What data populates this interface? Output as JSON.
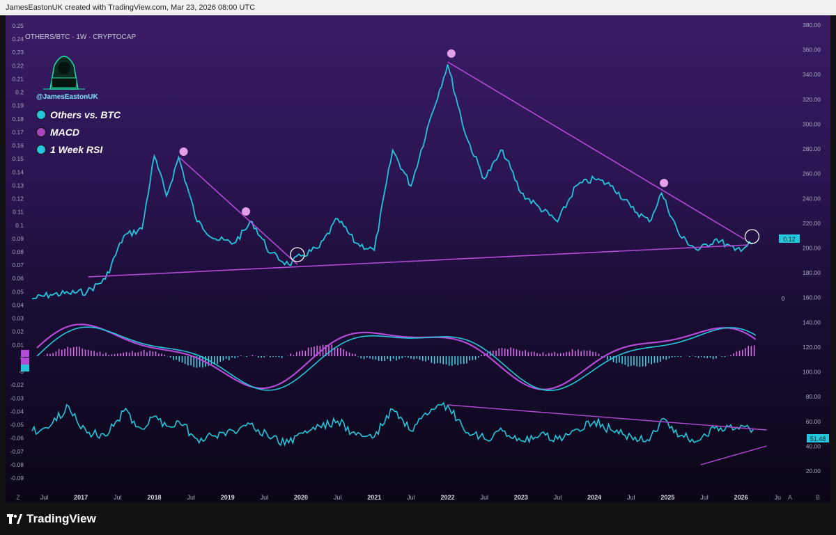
{
  "header": {
    "text": "JamesEastonUK created with TradingView.com, Mar 23, 2026 08:00 UTC"
  },
  "symbol": "OTHERS/BTC · 1W · CRYPTOCAP",
  "watermark": {
    "handle": "@JamesEastonUK"
  },
  "legend": [
    {
      "label": "Others vs. BTC",
      "color": "#26c6da"
    },
    {
      "label": "MACD",
      "color": "#ab47bc"
    },
    {
      "label": "1 Week RSI",
      "color": "#26c6da"
    }
  ],
  "footer": {
    "brand": "TradingView",
    "logo_icon": "tradingview-logo-icon"
  },
  "badges": {
    "price": "0.12",
    "rsi": "51.48",
    "macd_zero": "0"
  },
  "colors": {
    "line": "#26c6da",
    "magenta": "#b44bd6",
    "pink_dot": "#e3a0e8",
    "bar_pos": "#d36ee6",
    "bar_neg": "#4dd0e1"
  },
  "chart_data": {
    "type": "line",
    "title": "OTHERS/BTC · 1W · CRYPTOCAP",
    "x_ticks": [
      "Jul",
      "2017",
      "Jul",
      "2018",
      "Jul",
      "2019",
      "Jul",
      "2020",
      "Jul",
      "2021",
      "Jul",
      "2022",
      "Jul",
      "2023",
      "Jul",
      "2024",
      "Jul",
      "2025",
      "Jul",
      "2026",
      "Ju"
    ],
    "left_axis_ticks": [
      "0.25",
      "0.24",
      "0.23",
      "0.22",
      "0.21",
      "0.2",
      "0.19",
      "0.18",
      "0.17",
      "0.16",
      "0.15",
      "0.14",
      "0.13",
      "0.12",
      "0.11",
      "0.1",
      "0.09",
      "0.08",
      "0.07",
      "0.06",
      "0.05",
      "0.04",
      "0.03",
      "0.02",
      "0.01",
      "0",
      "-0",
      "-0.02",
      "-0.03",
      "-0.04",
      "-0.05",
      "-0.06",
      "-0.07",
      "-0.08",
      "-0.09"
    ],
    "right_axis_ticks": [
      "380.00",
      "360.00",
      "340.00",
      "320.00",
      "300.00",
      "280.00",
      "260.00",
      "240.00",
      "220.00",
      "200.00",
      "180.00",
      "160.00",
      "140.00",
      "120.00",
      "100.00",
      "80.00",
      "60.00",
      "40.00",
      "20.00"
    ],
    "axis_corner_labels": {
      "left": "Z",
      "auto": "A",
      "log": "B"
    },
    "series": [
      {
        "name": "Others vs. BTC",
        "x": [
          "2016-05",
          "2016-08",
          "2016-11",
          "2017-02",
          "2017-05",
          "2017-08",
          "2017-11",
          "2018-01",
          "2018-03",
          "2018-05",
          "2018-08",
          "2018-11",
          "2019-02",
          "2019-05",
          "2019-08",
          "2019-11",
          "2020-01",
          "2020-04",
          "2020-07",
          "2020-10",
          "2021-01",
          "2021-04",
          "2021-07",
          "2021-10",
          "2022-01",
          "2022-04",
          "2022-07",
          "2022-10",
          "2023-01",
          "2023-04",
          "2023-07",
          "2023-10",
          "2024-01",
          "2024-04",
          "2024-07",
          "2024-10",
          "2024-12",
          "2025-03",
          "2025-06",
          "2025-09",
          "2025-12",
          "2026-03"
        ],
        "values": [
          0.046,
          0.049,
          0.05,
          0.051,
          0.06,
          0.09,
          0.095,
          0.146,
          0.118,
          0.145,
          0.1,
          0.088,
          0.085,
          0.1,
          0.078,
          0.07,
          0.076,
          0.082,
          0.102,
          0.085,
          0.08,
          0.15,
          0.125,
          0.17,
          0.21,
          0.16,
          0.13,
          0.15,
          0.12,
          0.11,
          0.1,
          0.125,
          0.13,
          0.125,
          0.11,
          0.1,
          0.12,
          0.09,
          0.08,
          0.088,
          0.08,
          0.085
        ]
      },
      {
        "name": "1 Week RSI",
        "x": [
          "2016-05",
          "2016-08",
          "2016-11",
          "2017-02",
          "2017-05",
          "2017-08",
          "2017-11",
          "2018-01",
          "2018-03",
          "2018-05",
          "2018-08",
          "2018-11",
          "2019-02",
          "2019-05",
          "2019-08",
          "2019-11",
          "2020-01",
          "2020-04",
          "2020-07",
          "2020-10",
          "2021-01",
          "2021-04",
          "2021-07",
          "2021-10",
          "2022-01",
          "2022-04",
          "2022-07",
          "2022-10",
          "2023-01",
          "2023-04",
          "2023-07",
          "2023-10",
          "2024-01",
          "2024-04",
          "2024-07",
          "2024-10",
          "2024-12",
          "2025-03",
          "2025-06",
          "2025-09",
          "2025-12",
          "2026-03"
        ],
        "values": [
          50,
          55,
          75,
          48,
          45,
          70,
          52,
          65,
          55,
          60,
          42,
          45,
          50,
          58,
          42,
          38,
          48,
          55,
          60,
          46,
          44,
          72,
          50,
          68,
          76,
          48,
          42,
          50,
          40,
          45,
          42,
          52,
          60,
          50,
          45,
          40,
          62,
          45,
          40,
          55,
          52,
          51.48
        ]
      }
    ]
  }
}
